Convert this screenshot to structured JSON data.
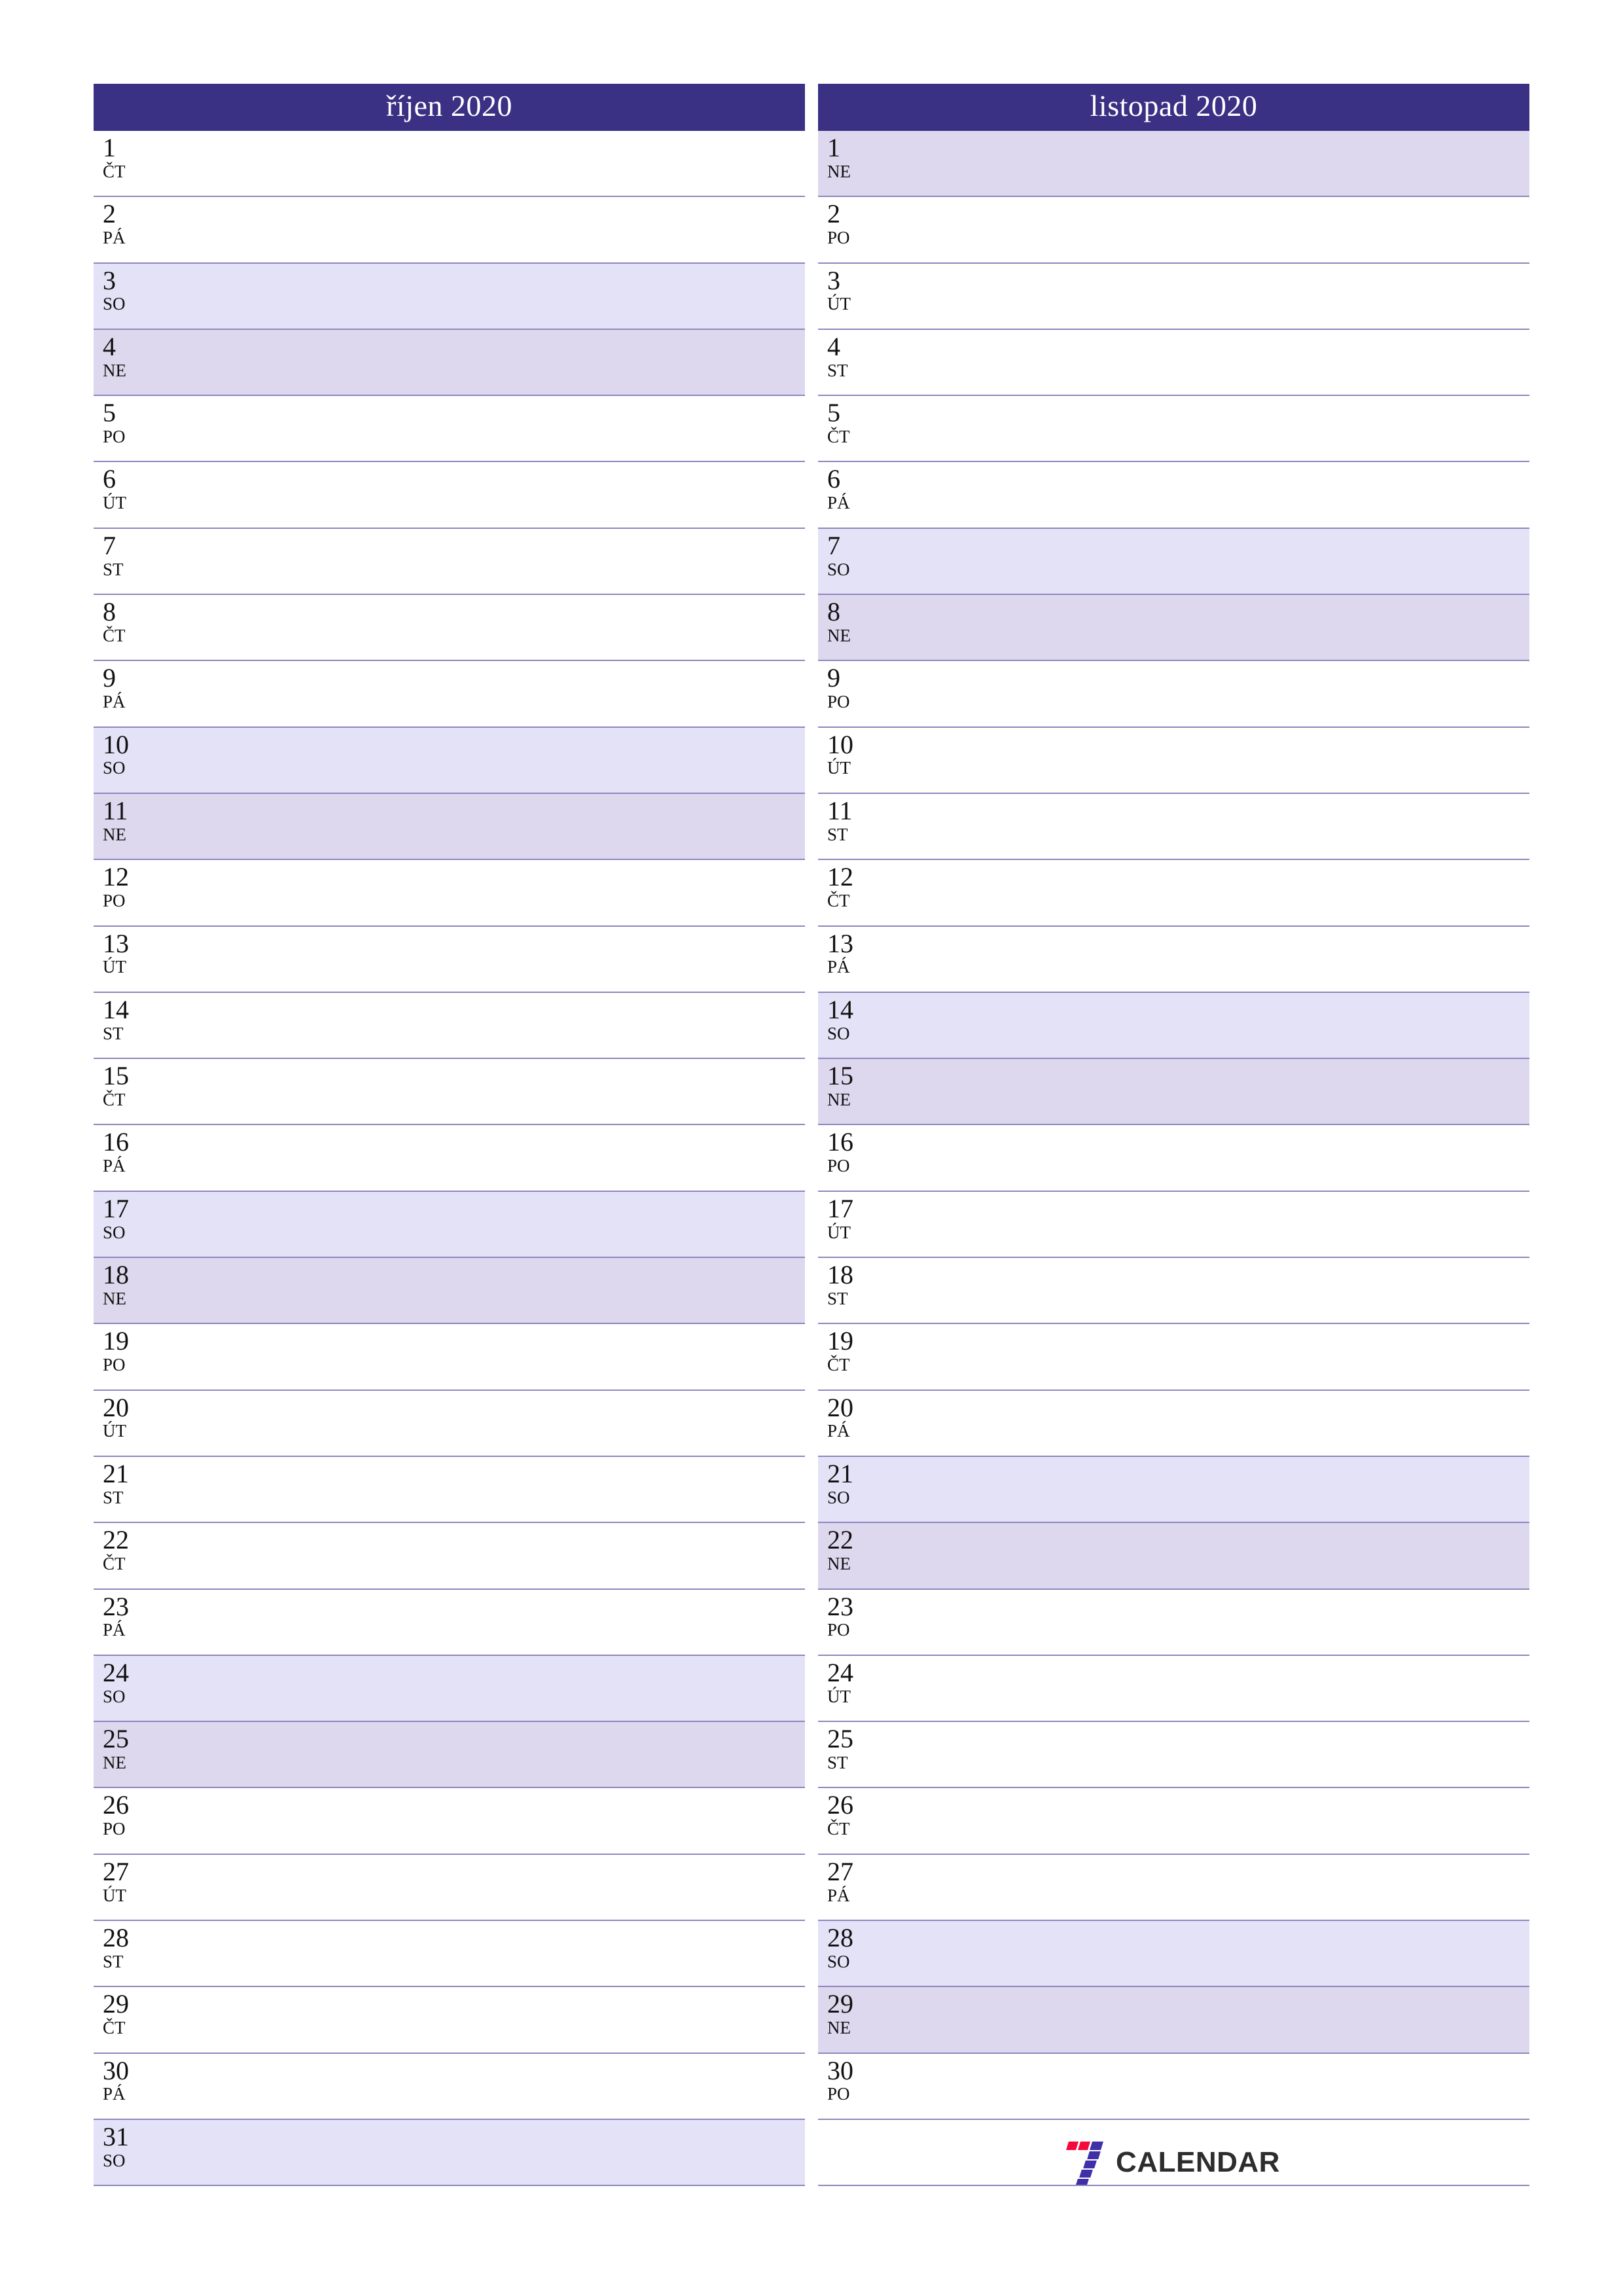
{
  "document": {
    "type": "monthly-planner",
    "language": "cs",
    "orientation": "portrait"
  },
  "colors": {
    "header_bg": "#3a3184",
    "header_text": "#ffffff",
    "saturday_bg": "#e3e2f7",
    "sunday_bg": "#ddd8ee",
    "row_border": "#8d86bd",
    "text": "#111111",
    "logo_red": "#f5083c",
    "logo_purple": "#3f2fa8",
    "logo_word": "#2d2d2f"
  },
  "months": [
    {
      "title": "říjen 2020",
      "days": [
        {
          "num": "1",
          "dow": "ČT",
          "kind": "weekday"
        },
        {
          "num": "2",
          "dow": "PÁ",
          "kind": "weekday"
        },
        {
          "num": "3",
          "dow": "SO",
          "kind": "sat"
        },
        {
          "num": "4",
          "dow": "NE",
          "kind": "sun"
        },
        {
          "num": "5",
          "dow": "PO",
          "kind": "weekday"
        },
        {
          "num": "6",
          "dow": "ÚT",
          "kind": "weekday"
        },
        {
          "num": "7",
          "dow": "ST",
          "kind": "weekday"
        },
        {
          "num": "8",
          "dow": "ČT",
          "kind": "weekday"
        },
        {
          "num": "9",
          "dow": "PÁ",
          "kind": "weekday"
        },
        {
          "num": "10",
          "dow": "SO",
          "kind": "sat"
        },
        {
          "num": "11",
          "dow": "NE",
          "kind": "sun"
        },
        {
          "num": "12",
          "dow": "PO",
          "kind": "weekday"
        },
        {
          "num": "13",
          "dow": "ÚT",
          "kind": "weekday"
        },
        {
          "num": "14",
          "dow": "ST",
          "kind": "weekday"
        },
        {
          "num": "15",
          "dow": "ČT",
          "kind": "weekday"
        },
        {
          "num": "16",
          "dow": "PÁ",
          "kind": "weekday"
        },
        {
          "num": "17",
          "dow": "SO",
          "kind": "sat"
        },
        {
          "num": "18",
          "dow": "NE",
          "kind": "sun"
        },
        {
          "num": "19",
          "dow": "PO",
          "kind": "weekday"
        },
        {
          "num": "20",
          "dow": "ÚT",
          "kind": "weekday"
        },
        {
          "num": "21",
          "dow": "ST",
          "kind": "weekday"
        },
        {
          "num": "22",
          "dow": "ČT",
          "kind": "weekday"
        },
        {
          "num": "23",
          "dow": "PÁ",
          "kind": "weekday"
        },
        {
          "num": "24",
          "dow": "SO",
          "kind": "sat"
        },
        {
          "num": "25",
          "dow": "NE",
          "kind": "sun"
        },
        {
          "num": "26",
          "dow": "PO",
          "kind": "weekday"
        },
        {
          "num": "27",
          "dow": "ÚT",
          "kind": "weekday"
        },
        {
          "num": "28",
          "dow": "ST",
          "kind": "weekday"
        },
        {
          "num": "29",
          "dow": "ČT",
          "kind": "weekday"
        },
        {
          "num": "30",
          "dow": "PÁ",
          "kind": "weekday"
        },
        {
          "num": "31",
          "dow": "SO",
          "kind": "sat"
        }
      ]
    },
    {
      "title": "listopad 2020",
      "days": [
        {
          "num": "1",
          "dow": "NE",
          "kind": "sun"
        },
        {
          "num": "2",
          "dow": "PO",
          "kind": "weekday"
        },
        {
          "num": "3",
          "dow": "ÚT",
          "kind": "weekday"
        },
        {
          "num": "4",
          "dow": "ST",
          "kind": "weekday"
        },
        {
          "num": "5",
          "dow": "ČT",
          "kind": "weekday"
        },
        {
          "num": "6",
          "dow": "PÁ",
          "kind": "weekday"
        },
        {
          "num": "7",
          "dow": "SO",
          "kind": "sat"
        },
        {
          "num": "8",
          "dow": "NE",
          "kind": "sun"
        },
        {
          "num": "9",
          "dow": "PO",
          "kind": "weekday"
        },
        {
          "num": "10",
          "dow": "ÚT",
          "kind": "weekday"
        },
        {
          "num": "11",
          "dow": "ST",
          "kind": "weekday"
        },
        {
          "num": "12",
          "dow": "ČT",
          "kind": "weekday"
        },
        {
          "num": "13",
          "dow": "PÁ",
          "kind": "weekday"
        },
        {
          "num": "14",
          "dow": "SO",
          "kind": "sat"
        },
        {
          "num": "15",
          "dow": "NE",
          "kind": "sun"
        },
        {
          "num": "16",
          "dow": "PO",
          "kind": "weekday"
        },
        {
          "num": "17",
          "dow": "ÚT",
          "kind": "weekday"
        },
        {
          "num": "18",
          "dow": "ST",
          "kind": "weekday"
        },
        {
          "num": "19",
          "dow": "ČT",
          "kind": "weekday"
        },
        {
          "num": "20",
          "dow": "PÁ",
          "kind": "weekday"
        },
        {
          "num": "21",
          "dow": "SO",
          "kind": "sat"
        },
        {
          "num": "22",
          "dow": "NE",
          "kind": "sun"
        },
        {
          "num": "23",
          "dow": "PO",
          "kind": "weekday"
        },
        {
          "num": "24",
          "dow": "ÚT",
          "kind": "weekday"
        },
        {
          "num": "25",
          "dow": "ST",
          "kind": "weekday"
        },
        {
          "num": "26",
          "dow": "ČT",
          "kind": "weekday"
        },
        {
          "num": "27",
          "dow": "PÁ",
          "kind": "weekday"
        },
        {
          "num": "28",
          "dow": "SO",
          "kind": "sat"
        },
        {
          "num": "29",
          "dow": "NE",
          "kind": "sun"
        },
        {
          "num": "30",
          "dow": "PO",
          "kind": "weekday"
        },
        {
          "num": "",
          "dow": "",
          "kind": "logo"
        }
      ]
    }
  ],
  "logo": {
    "mark": "seven-logo-icon",
    "word": "CALENDAR"
  }
}
